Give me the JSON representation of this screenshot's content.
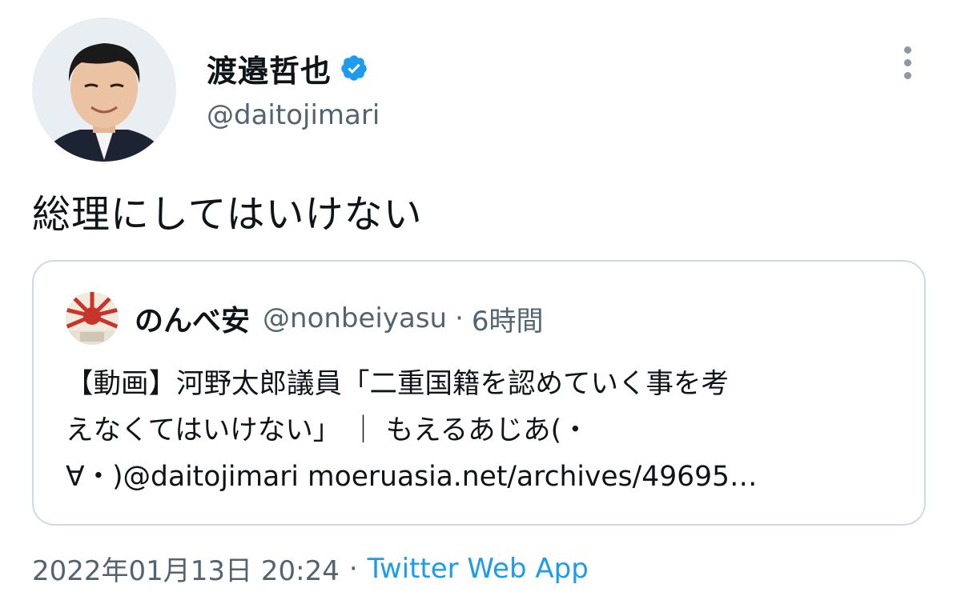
{
  "author": {
    "display_name": "渡邉哲也",
    "handle": "@daitojimari",
    "avatar_icon": "profile-photo",
    "verified_icon": "verified-badge-icon",
    "verified_color": "#1d9bf0"
  },
  "more_icon": "more-options-icon",
  "tweet_text": "総理にしてはいけない",
  "quote": {
    "avatar_icon": "rising-sun-flag-avatar",
    "display_name": "のんべ安",
    "handle": "@nonbeiyasu",
    "separator": "·",
    "time": "6時間",
    "body_lines": [
      "【動画】河野太郎議員「二重国籍を認めていく事を考",
      "えなくてはいけない」 ｜ もえるあじあ(・",
      "∀・)@daitojimari  moeruasia.net/archives/49695…"
    ]
  },
  "meta": {
    "timestamp": "2022年01月13日 20:24",
    "separator": "·",
    "source": "Twitter Web App",
    "source_color": "#1d9bf0"
  }
}
